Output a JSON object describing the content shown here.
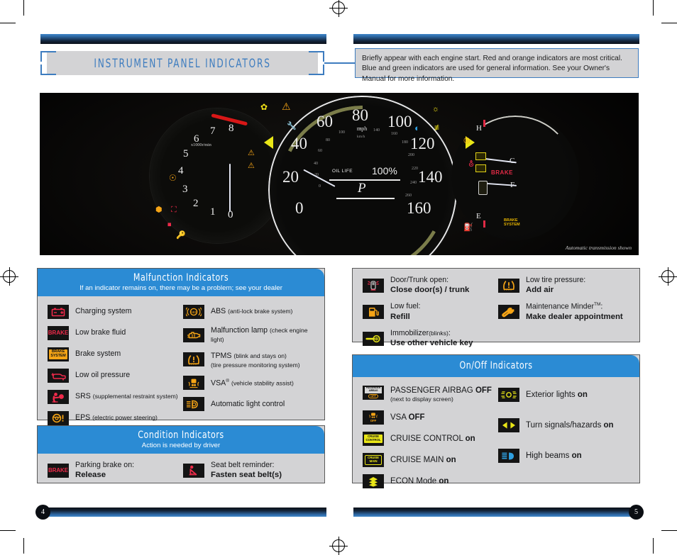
{
  "header": {
    "title": "INSTRUMENT PANEL INDICATORS",
    "note": "Briefly appear with each engine start. Red and orange indicators are most critical. Blue and green indicators are used for general information. See your Owner's Manual for more information."
  },
  "dashboard": {
    "caption": "Automatic transmission shown",
    "tachometer": {
      "unit": "x1000r/min",
      "ticks": [
        "0",
        "1",
        "2",
        "3",
        "4",
        "5",
        "6",
        "7",
        "8"
      ],
      "redline_from": "7"
    },
    "speedometer": {
      "unit_primary": "mph",
      "unit_secondary": "km/h",
      "mph_ticks": [
        "0",
        "20",
        "40",
        "60",
        "80",
        "100",
        "120",
        "140",
        "160"
      ],
      "kmh_ticks": [
        "0",
        "20",
        "40",
        "60",
        "80",
        "100",
        "120",
        "140",
        "160",
        "180",
        "200",
        "220",
        "240",
        "260"
      ]
    },
    "display": {
      "oil_life_label": "OIL LIFE",
      "oil_life_value": "100%",
      "gear": "P"
    },
    "right_gauge": {
      "temp_high": "H",
      "temp_cold": "C",
      "fuel_full": "F",
      "fuel_empty": "E",
      "brake_text": "BRAKE",
      "brake_system_text": "BRAKE SYSTEM"
    }
  },
  "malfunction": {
    "title": "Malfunction Indicators",
    "subtitle": "If an indicator remains on, there may be a problem; see your dealer",
    "left": [
      {
        "icon": "charging-system-icon",
        "label": "Charging system",
        "note": ""
      },
      {
        "icon": "low-brake-fluid-icon",
        "label": "Low brake fluid",
        "note": ""
      },
      {
        "icon": "brake-system-icon",
        "label": "Brake system",
        "note": ""
      },
      {
        "icon": "low-oil-pressure-icon",
        "label": "Low oil pressure",
        "note": ""
      },
      {
        "icon": "srs-airbag-icon",
        "label": "SRS",
        "note": "(supplemental restraint system)"
      },
      {
        "icon": "eps-icon",
        "label": "EPS",
        "note": "(electric power steering)"
      }
    ],
    "right": [
      {
        "icon": "abs-icon",
        "label": "ABS",
        "note": "(anti-lock brake system)"
      },
      {
        "icon": "malfunction-lamp-icon",
        "label": "Malfunction lamp",
        "note": "(check engine light)"
      },
      {
        "icon": "tpms-icon",
        "label": "TPMS",
        "note": "(blink and stays on)",
        "note2": "(tire pressure monitoring system)"
      },
      {
        "icon": "vsa-icon",
        "label": "VSA",
        "sup": "®",
        "note": "(vehicle stability assist)"
      },
      {
        "icon": "automatic-light-control-icon",
        "label": "Automatic light control",
        "note": ""
      }
    ]
  },
  "condition": {
    "title": "Condition Indicators",
    "subtitle": "Action is needed by driver",
    "items": [
      {
        "icon": "parking-brake-icon",
        "line1": "Parking brake on:",
        "line2": "Release"
      },
      {
        "icon": "seat-belt-reminder-icon",
        "line1": "Seat belt reminder:",
        "line2": "Fasten seat belt(s)"
      }
    ]
  },
  "reminders": {
    "left": [
      {
        "icon": "door-trunk-open-icon",
        "line1": "Door/Trunk open:",
        "line2": "Close door(s) / trunk"
      },
      {
        "icon": "low-fuel-icon",
        "line1": "Low fuel:",
        "line2": "Refill"
      },
      {
        "icon": "immobilizer-icon",
        "line1": "Immobilizer",
        "note": "(blinks)",
        "suffix": ":",
        "line2": "Use other vehicle key"
      }
    ],
    "right": [
      {
        "icon": "low-tire-pressure-icon",
        "line1": "Low tire pressure:",
        "line2": "Add air"
      },
      {
        "icon": "maintenance-minder-icon",
        "line1": "Maintenance Minder",
        "sup": "TM",
        "suffix": ":",
        "line2": "Make dealer appointment"
      }
    ]
  },
  "onoff": {
    "title": "On/Off Indicators",
    "left": [
      {
        "icon": "passenger-airbag-off-icon",
        "label": "PASSENGER AIRBAG ",
        "bold": "OFF",
        "note": "(next to display screen)"
      },
      {
        "icon": "vsa-off-icon",
        "label": "VSA ",
        "bold": "OFF",
        "note": ""
      },
      {
        "icon": "cruise-control-icon",
        "label": "CRUISE CONTROL ",
        "bold": "on",
        "note": ""
      },
      {
        "icon": "cruise-main-icon",
        "label": "CRUISE MAIN ",
        "bold": "on",
        "note": ""
      },
      {
        "icon": "econ-mode-icon",
        "label": "ECON Mode ",
        "bold": "on",
        "note": ""
      }
    ],
    "right": [
      {
        "icon": "exterior-lights-icon",
        "label": "Exterior lights ",
        "bold": "on",
        "note": ""
      },
      {
        "icon": "turn-signal-icon",
        "label": "Turn signals/hazards ",
        "bold": "on",
        "note": ""
      },
      {
        "icon": "high-beams-icon",
        "label": "High beams ",
        "bold": "on",
        "note": ""
      }
    ]
  },
  "footer": {
    "page_left": "4",
    "page_right": "5"
  },
  "colors": {
    "accent_blue": "#2b8bd4",
    "title_blue": "#3d7cbf",
    "panel_gray": "#d3d3d5",
    "red": "#ef2a4a",
    "amber": "#f5a416",
    "yellow": "#f2e317"
  }
}
